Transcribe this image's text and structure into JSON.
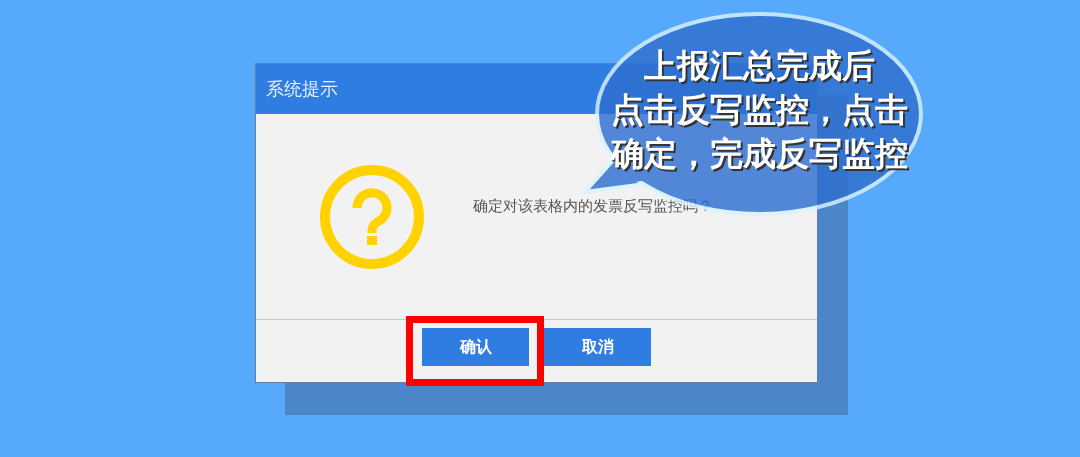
{
  "dialog": {
    "title": "系统提示",
    "message": "确定对该表格内的发票反写监控吗？",
    "buttons": [
      {
        "label": "确认",
        "highlighted": true
      },
      {
        "label": "取消",
        "highlighted": false
      }
    ]
  },
  "callout": {
    "lines": [
      "上报汇总完成后",
      "点击反写监控，点击",
      "确定，完成反写监控"
    ]
  }
}
